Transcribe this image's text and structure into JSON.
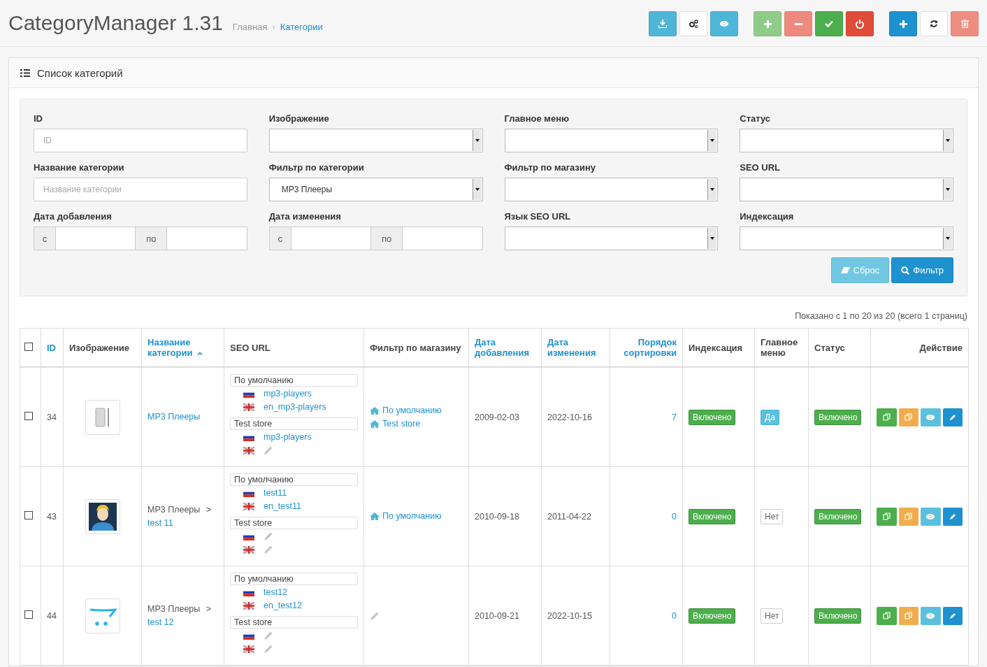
{
  "header": {
    "title": "CategoryManager 1.31",
    "breadcrumb": [
      {
        "text": "Главная",
        "link": false
      },
      {
        "text": "›",
        "link": false,
        "kind": "separator"
      },
      {
        "text": "Категории",
        "link": true
      }
    ]
  },
  "toolbar_groups": [
    {
      "buttons": [
        {
          "kind": "download",
          "color": "#4fb6d8"
        },
        {
          "kind": "cogs",
          "color": "#ffffff"
        },
        {
          "kind": "eye",
          "color": "#4fb6d8"
        }
      ]
    },
    {
      "buttons": [
        {
          "kind": "plus",
          "color": "#8fcc8a"
        },
        {
          "kind": "minus",
          "color": "#ed8a7d"
        },
        {
          "kind": "check",
          "color": "#4cae4c"
        },
        {
          "kind": "power",
          "color": "#e04b3a"
        }
      ]
    },
    {
      "buttons": [
        {
          "kind": "plus",
          "color": "#1e91cf"
        },
        {
          "kind": "refresh",
          "color": "#ffffff"
        },
        {
          "kind": "trash",
          "color": "#ee8e82"
        }
      ]
    }
  ],
  "panel": {
    "title": "Список категорий"
  },
  "filters": [
    {
      "label": "ID",
      "kind": "text",
      "placeholder": "ID"
    },
    {
      "label": "Изображение",
      "kind": "select"
    },
    {
      "label": "Главное меню",
      "kind": "select"
    },
    {
      "label": "Статус",
      "kind": "select"
    },
    {
      "label": "Название категории",
      "kind": "text",
      "placeholder": "Название категории"
    },
    {
      "label": "Фильтр по категории",
      "kind": "select",
      "value": "MP3 Плееры"
    },
    {
      "label": "Фильтр по магазину",
      "kind": "select"
    },
    {
      "label": "SEO URL",
      "kind": "select"
    },
    {
      "label": "Дата добавления",
      "kind": "daterange",
      "from": "с",
      "to": "по"
    },
    {
      "label": "Дата изменения",
      "kind": "daterange",
      "from": "с",
      "to": "по"
    },
    {
      "label": "Язык SEO URL",
      "kind": "select"
    },
    {
      "label": "Индексация",
      "kind": "select"
    }
  ],
  "filter_buttons": [
    {
      "label": "Сброс",
      "kind": "reset"
    },
    {
      "label": "Фильтр",
      "kind": "filter"
    }
  ],
  "pagination_text": "Показано с 1 по 20 из 20 (всего 1 страниц)",
  "table": {
    "select_all": {
      "checked": false
    },
    "columns": [
      {
        "label": "ID",
        "sortable": true
      },
      {
        "label": "Изображение",
        "sortable": false
      },
      {
        "label": "Название категории",
        "sortable": true,
        "sorted": true
      },
      {
        "label": "SEO URL",
        "sortable": false
      },
      {
        "label": "Фильтр по магазину",
        "sortable": false
      },
      {
        "label": "Дата добавления",
        "sortable": true
      },
      {
        "label": "Дата изменения",
        "sortable": true
      },
      {
        "label": "Порядок сортировки",
        "sortable": true
      },
      {
        "label": "Индексация",
        "sortable": false
      },
      {
        "label": "Главное меню",
        "sortable": false
      },
      {
        "label": "Статус",
        "sortable": false
      },
      {
        "label": "Действие",
        "sortable": false
      }
    ],
    "rows": [
      {
        "checked": false,
        "id": "34",
        "image": {
          "kind": "phone"
        },
        "name": {
          "current": "MP3 Плееры"
        },
        "seo": [
          {
            "store": "По умолчанию",
            "urls": [
              {
                "kind": "ru",
                "text": "mp3-players"
              },
              {
                "kind": "en",
                "text": "en_mp3-players"
              }
            ]
          },
          {
            "store": "Test store",
            "urls": [
              {
                "kind": "ru",
                "text": "mp3-players"
              },
              {
                "kind": "en"
              }
            ]
          }
        ],
        "stores": [
          "По умолчанию",
          "Test store"
        ],
        "date_added": "2009-02-03",
        "date_modified": "2022-10-16",
        "sort_order": "7",
        "indexing": {
          "text": "Включено",
          "on": true
        },
        "main_menu": {
          "text": "Да",
          "on": true
        },
        "status": {
          "text": "Включено",
          "on": true
        },
        "actions": [
          {
            "kind": "copy",
            "color": "#4cae4c"
          },
          {
            "kind": "copy",
            "color": "#f0ad4e"
          },
          {
            "kind": "eye",
            "color": "#5bc0de"
          },
          {
            "kind": "pencil",
            "color": "#1e91cf"
          }
        ]
      },
      {
        "checked": false,
        "id": "43",
        "image": {
          "kind": "avatar"
        },
        "name": {
          "parent": "MP3 Плееры",
          "separator": ">",
          "current": "test 11"
        },
        "seo": [
          {
            "store": "По умолчанию",
            "urls": [
              {
                "kind": "ru",
                "text": "test11"
              },
              {
                "kind": "en",
                "text": "en_test11"
              }
            ]
          },
          {
            "store": "Test store",
            "urls": [
              {
                "kind": "ru"
              },
              {
                "kind": "en"
              }
            ]
          }
        ],
        "stores": [
          "По умолчанию"
        ],
        "date_added": "2010-09-18",
        "date_modified": "2011-04-22",
        "sort_order": "0",
        "indexing": {
          "text": "Включено",
          "on": true
        },
        "main_menu": {
          "text": "Нет",
          "on": false
        },
        "status": {
          "text": "Включено",
          "on": true
        },
        "actions": [
          {
            "kind": "copy",
            "color": "#4cae4c"
          },
          {
            "kind": "copy",
            "color": "#f0ad4e"
          },
          {
            "kind": "eye",
            "color": "#5bc0de"
          },
          {
            "kind": "pencil",
            "color": "#1e91cf"
          }
        ]
      },
      {
        "checked": false,
        "id": "44",
        "image": {
          "kind": "cart"
        },
        "name": {
          "parent": "MP3 Плееры",
          "separator": ">",
          "current": "test 12"
        },
        "seo": [
          {
            "store": "По умолчанию",
            "urls": [
              {
                "kind": "ru",
                "text": "test12"
              },
              {
                "kind": "en",
                "text": "en_test12"
              }
            ]
          },
          {
            "store": "Test store",
            "urls": [
              {
                "kind": "ru"
              },
              {
                "kind": "en"
              }
            ]
          }
        ],
        "date_added": "2010-09-21",
        "date_modified": "2022-10-15",
        "sort_order": "0",
        "indexing": {
          "text": "Включено",
          "on": true
        },
        "main_menu": {
          "text": "Нет",
          "on": false
        },
        "status": {
          "text": "Включено",
          "on": true
        },
        "actions": [
          {
            "kind": "copy",
            "color": "#4cae4c"
          },
          {
            "kind": "copy",
            "color": "#f0ad4e"
          },
          {
            "kind": "eye",
            "color": "#5bc0de"
          },
          {
            "kind": "pencil",
            "color": "#1e91cf"
          }
        ]
      }
    ]
  }
}
